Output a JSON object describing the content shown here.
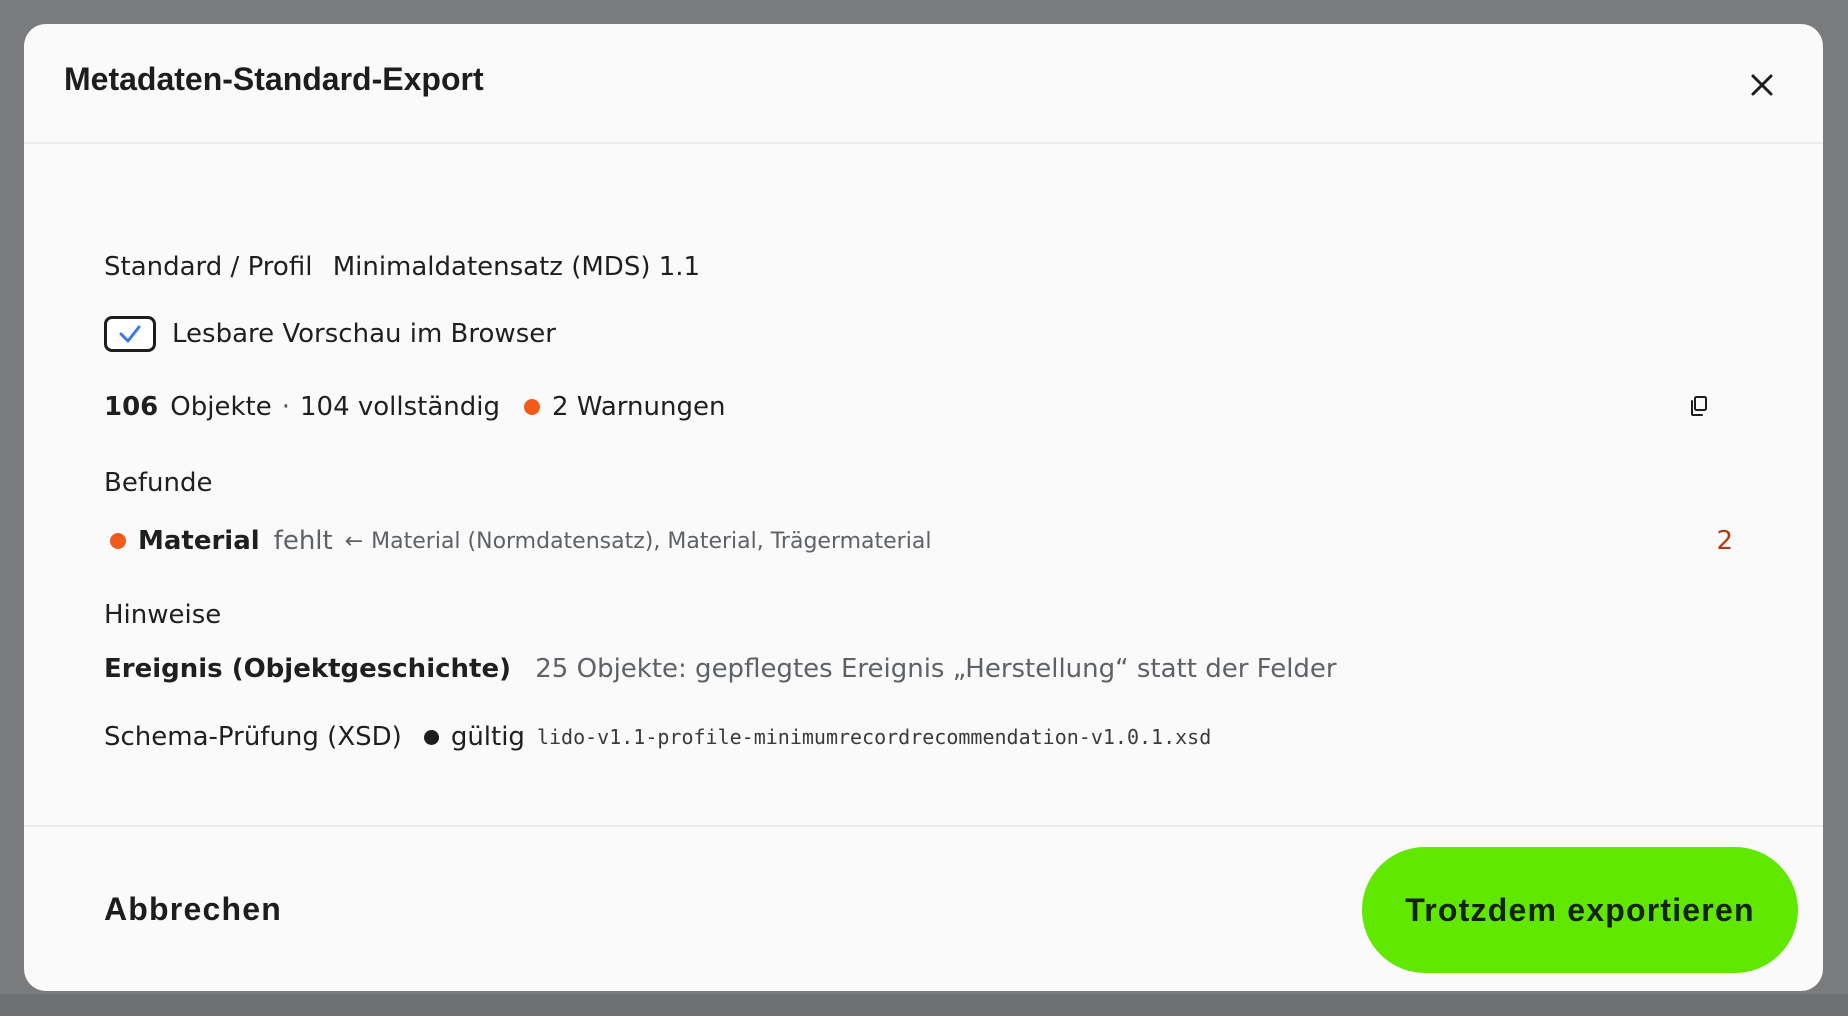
{
  "dialog": {
    "title": "Metadaten-Standard-Export"
  },
  "profile": {
    "label": "Standard / Profil",
    "value": "Minimaldatensatz (MDS) 1.1"
  },
  "preview": {
    "label": "Lesbare Vorschau im Browser",
    "checked": true
  },
  "summary": {
    "count": "106",
    "objects_label": "Objekte",
    "separator": "·",
    "complete": "104 vollständig",
    "warnings": "2 Warnungen",
    "warning_color": "#f05a1a"
  },
  "findings": {
    "heading": "Befunde",
    "items": [
      {
        "field": "Material",
        "status": "fehlt",
        "arrow": "←",
        "sources": "Material (Normdatensatz), Material, Trägermaterial",
        "count": "2"
      }
    ]
  },
  "hints": {
    "heading": "Hinweise",
    "items": [
      {
        "field": "Ereignis (Objektgeschichte)",
        "text": "25 Objekte: gepflegtes Ereignis „Herstellung“ statt der Felder"
      }
    ]
  },
  "schema": {
    "label": "Schema-Prüfung (XSD)",
    "status": "gültig",
    "file": "lido-v1.1-profile-minimumrecordrecommendation-v1.0.1.xsd",
    "status_color": "#1d1d1d"
  },
  "footer": {
    "cancel_label": "Abbrechen",
    "export_label": "Trotzdem exportieren",
    "export_color": "#61e800"
  },
  "icons": {
    "close": "close-icon",
    "copy": "copy-icon",
    "check": "checkmark-icon"
  }
}
